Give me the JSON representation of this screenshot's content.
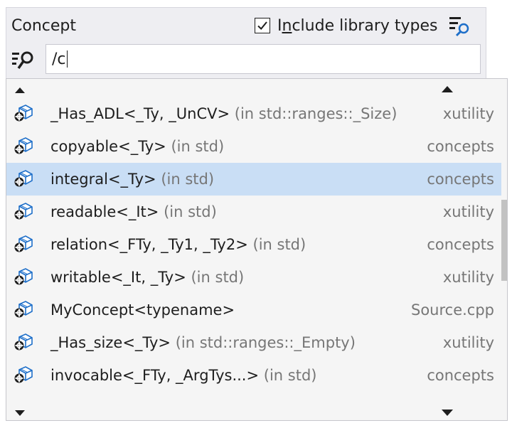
{
  "header": {
    "title": "Concept",
    "include_library_types": {
      "label_pre": "I",
      "label_u": "n",
      "label_post": "clude library types",
      "checked": true
    },
    "filter_icon": "filter-search-icon"
  },
  "search": {
    "icon": "search-filter-icon",
    "value": "/c"
  },
  "results": [
    {
      "name": "_Has_ADL<_Ty, _UnCV>",
      "scope": "(in std::ranges::_Size)",
      "source": "xutility",
      "selected": false
    },
    {
      "name": "copyable<_Ty>",
      "scope": "(in std)",
      "source": "concepts",
      "selected": false
    },
    {
      "name": "integral<_Ty>",
      "scope": "(in std)",
      "source": "concepts",
      "selected": true
    },
    {
      "name": "readable<_It>",
      "scope": "(in std)",
      "source": "xutility",
      "selected": false
    },
    {
      "name": "relation<_FTy, _Ty1, _Ty2>",
      "scope": "(in std)",
      "source": "concepts",
      "selected": false
    },
    {
      "name": "writable<_It, _Ty>",
      "scope": "(in std)",
      "source": "xutility",
      "selected": false
    },
    {
      "name": "MyConcept<typename>",
      "scope": "",
      "source": "Source.cpp",
      "selected": false
    },
    {
      "name": "_Has_size<_Ty>",
      "scope": "(in std::ranges::_Empty)",
      "source": "xutility",
      "selected": false
    },
    {
      "name": "invocable<_FTy, _ArgTys...>",
      "scope": "(in std)",
      "source": "concepts",
      "selected": false
    }
  ],
  "colors": {
    "selected_row": "#c9def5",
    "icon_blue": "#1e6fc9",
    "muted_text": "#767676"
  }
}
